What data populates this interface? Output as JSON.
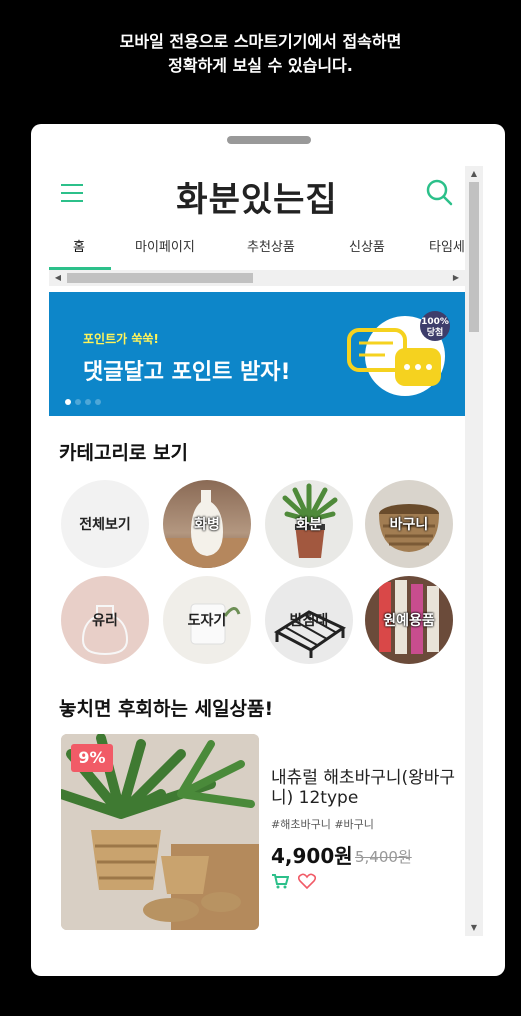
{
  "notice": {
    "line1": "모바일 전용으로 스마트기기에서 접속하면",
    "line2": "정확하게 보실 수 있습니다."
  },
  "header": {
    "brand": "화분있는집",
    "menu_icon": "hamburger-menu-icon",
    "search_icon": "search-icon"
  },
  "tabs": [
    "홈",
    "마이페이지",
    "추천상품",
    "신상품",
    "타임세"
  ],
  "banner": {
    "sub": "포인트가 쑥쑥!",
    "main": "댓글달고 포인트 받자!",
    "badge_line1": "100%",
    "badge_line2": "당첨",
    "slide_total": 4,
    "slide_active": 1
  },
  "categories": {
    "title": "카테고리로 보기",
    "items": [
      "전체보기",
      "화병",
      "화분",
      "바구니",
      "유리",
      "도자기",
      "받침대",
      "원예용품"
    ]
  },
  "sale": {
    "title": "놓치면 후회하는 세일상품!",
    "product": {
      "discount": "9%",
      "name": "내츄럴 해초바구니(왕바구니) 12type",
      "tags": "#해초바구니 #바구니",
      "price": "4,900원",
      "original_price": "5,400원",
      "cart_icon": "cart-icon",
      "wish_icon": "heart-icon"
    }
  },
  "colors": {
    "accent": "#2cc08a",
    "banner_bg": "#0d86c9",
    "badge": "#f15b67"
  }
}
